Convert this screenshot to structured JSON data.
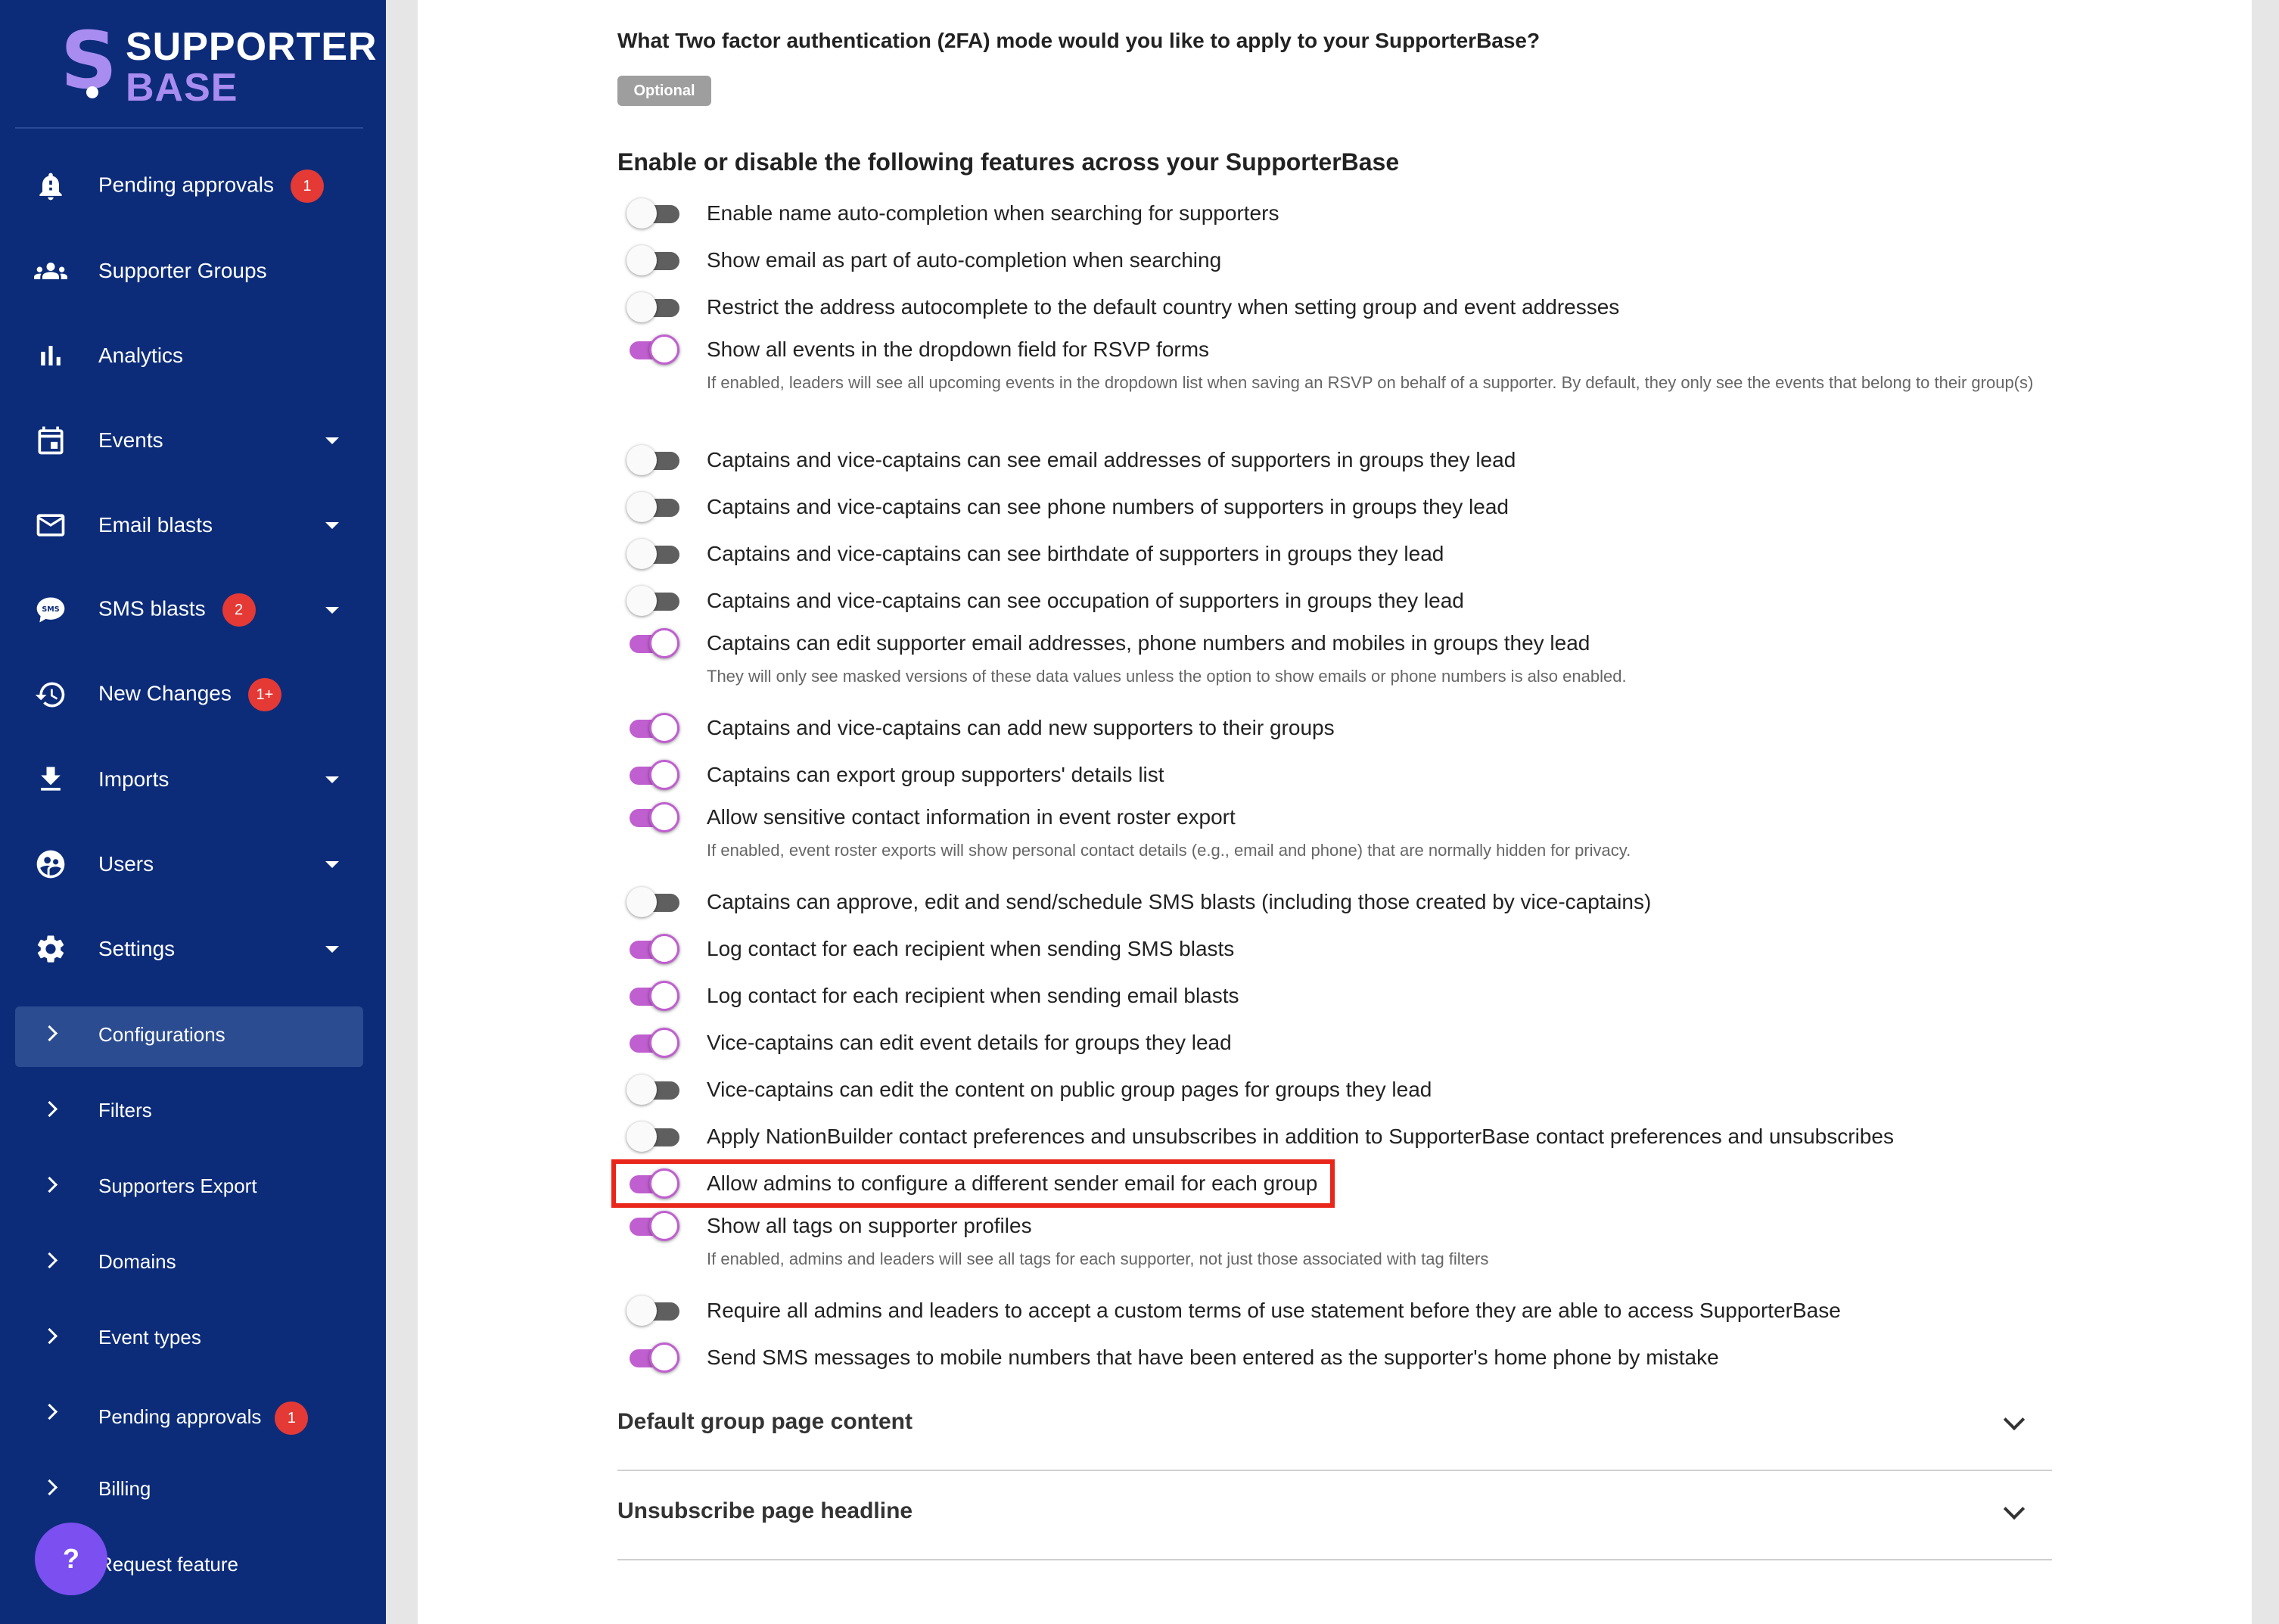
{
  "brand": {
    "line1": "SUPPORTER",
    "line2": "BASE",
    "mark": "S"
  },
  "nav": [
    {
      "label": "Pending approvals",
      "badge": "1",
      "icon": "bell-icon"
    },
    {
      "label": "Supporter Groups",
      "icon": "groups-icon"
    },
    {
      "label": "Analytics",
      "icon": "bar-chart-icon"
    },
    {
      "label": "Events",
      "icon": "calendar-icon",
      "expandable": true
    },
    {
      "label": "Email blasts",
      "icon": "mail-icon",
      "expandable": true
    },
    {
      "label": "SMS blasts",
      "badge": "2",
      "icon": "sms-icon",
      "expandable": true
    },
    {
      "label": "New Changes",
      "badge": "1+",
      "icon": "history-icon"
    },
    {
      "label": "Imports",
      "icon": "download-icon",
      "expandable": true
    },
    {
      "label": "Users",
      "icon": "users-icon",
      "expandable": true
    },
    {
      "label": "Settings",
      "icon": "gear-icon",
      "expandable": true
    }
  ],
  "settings_sub": [
    {
      "label": "Configurations",
      "active": true
    },
    {
      "label": "Filters"
    },
    {
      "label": "Supporters Export"
    },
    {
      "label": "Domains"
    },
    {
      "label": "Event types"
    },
    {
      "label": "Pending approvals",
      "badge": "1"
    },
    {
      "label": "Billing"
    },
    {
      "label": "Request feature"
    }
  ],
  "help_button": "?",
  "twofa": {
    "question": "What Two factor authentication (2FA) mode would you like to apply to your SupporterBase?",
    "value": "Optional"
  },
  "features_title": "Enable or disable the following features across your SupporterBase",
  "features": [
    {
      "label": "Enable name auto-completion when searching for supporters",
      "on": false
    },
    {
      "label": "Show email as part of auto-completion when searching",
      "on": false
    },
    {
      "label": "Restrict the address autocomplete to the default country when setting group and event addresses",
      "on": false
    },
    {
      "label": "Show all events in the dropdown field for RSVP forms",
      "on": true,
      "help": "If enabled, leaders will see all upcoming events in the dropdown list when saving an RSVP on behalf of a supporter. By default, they only see the events that belong to their group(s)"
    },
    {
      "label": "Captains and vice-captains can see email addresses of supporters in groups they lead",
      "on": false
    },
    {
      "label": "Captains and vice-captains can see phone numbers of supporters in groups they lead",
      "on": false
    },
    {
      "label": "Captains and vice-captains can see birthdate of supporters in groups they lead",
      "on": false
    },
    {
      "label": "Captains and vice-captains can see occupation of supporters in groups they lead",
      "on": false
    },
    {
      "label": "Captains can edit supporter email addresses, phone numbers and mobiles in groups they lead",
      "on": true,
      "help": "They will only see masked versions of these data values unless the option to show emails or phone numbers is also enabled."
    },
    {
      "label": "Captains and vice-captains can add new supporters to their groups",
      "on": true
    },
    {
      "label": "Captains can export group supporters' details list",
      "on": true
    },
    {
      "label": "Allow sensitive contact information in event roster export",
      "on": true,
      "help": "If enabled, event roster exports will show personal contact details (e.g., email and phone) that are normally hidden for privacy."
    },
    {
      "label": "Captains can approve, edit and send/schedule SMS blasts (including those created by vice-captains)",
      "on": false
    },
    {
      "label": "Log contact for each recipient when sending SMS blasts",
      "on": true
    },
    {
      "label": "Log contact for each recipient when sending email blasts",
      "on": true
    },
    {
      "label": "Vice-captains can edit event details for groups they lead",
      "on": true
    },
    {
      "label": "Vice-captains can edit the content on public group pages for groups they lead",
      "on": false
    },
    {
      "label": "Apply NationBuilder contact preferences and unsubscribes in addition to SupporterBase contact preferences and unsubscribes",
      "on": false
    },
    {
      "label": "Allow admins to configure a different sender email for each group",
      "on": true,
      "highlighted": true
    },
    {
      "label": "Show all tags on supporter profiles",
      "on": true,
      "help": "If enabled, admins and leaders will see all tags for each supporter, not just those associated with tag filters"
    },
    {
      "label": "Require all admins and leaders to accept a custom terms of use statement before they are able to access SupporterBase",
      "on": false
    },
    {
      "label": "Send SMS messages to mobile numbers that have been entered as the supporter's home phone by mistake",
      "on": true
    }
  ],
  "accordions": [
    {
      "label": "Default group page content"
    },
    {
      "label": "Unsubscribe page headline"
    }
  ],
  "colors": {
    "sidebar": "#0c2c7a",
    "toggle_on": "#c05fd0",
    "badge": "#e53935",
    "highlight": "#e8261a",
    "help_button": "#7b4ff0"
  }
}
